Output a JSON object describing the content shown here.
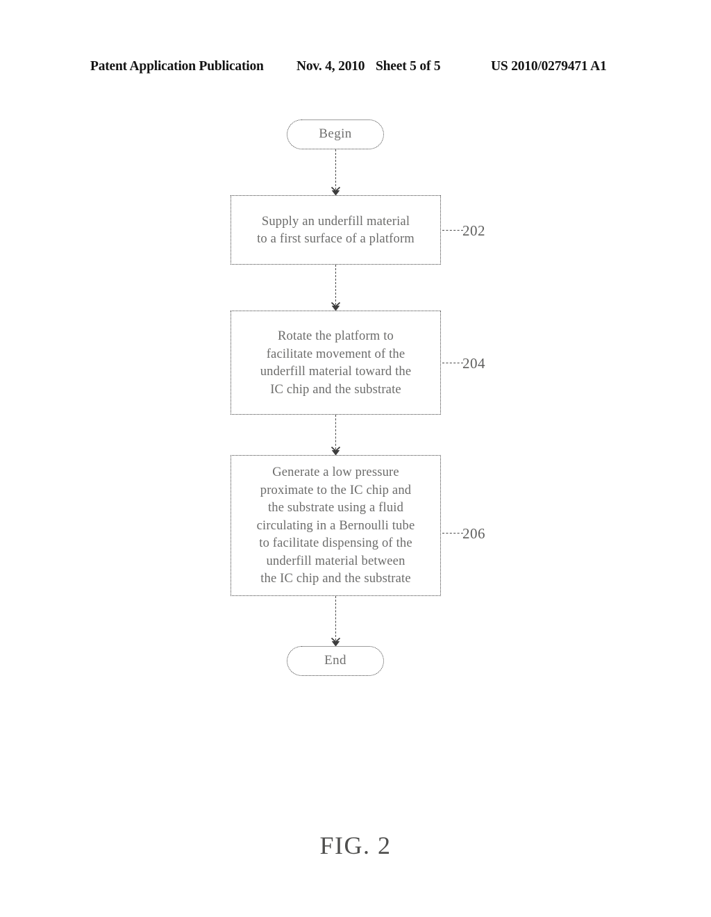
{
  "header": {
    "publication": "Patent Application Publication",
    "date": "Nov. 4, 2010",
    "sheet": "Sheet 5 of 5",
    "patent_number": "US 2010/0279471 A1"
  },
  "figure": {
    "caption": "FIG. 2",
    "ink_color": "#6c6c6b",
    "line_color": "#3d3d3d",
    "background": "#ffffff"
  },
  "flowchart": {
    "nodes": [
      {
        "id": "begin",
        "type": "terminal",
        "label": "Begin"
      },
      {
        "id": "202",
        "type": "process",
        "ref": "202",
        "text": "Supply an underfill material\nto a first surface of a platform"
      },
      {
        "id": "204",
        "type": "process",
        "ref": "204",
        "text": "Rotate the platform to\nfacilitate movement of the\nunderfill material toward the\nIC chip and the substrate"
      },
      {
        "id": "206",
        "type": "process",
        "ref": "206",
        "text": "Generate a low pressure\nproximate to the IC chip and\nthe substrate using a fluid\ncirculating in a Bernoulli tube\nto facilitate dispensing of the\nunderfill material  between\nthe  IC chip and the substrate"
      },
      {
        "id": "end",
        "type": "terminal",
        "label": "End"
      }
    ],
    "edges": [
      {
        "from": "begin",
        "to": "202",
        "style": "dashed",
        "arrow": true
      },
      {
        "from": "202",
        "to": "204",
        "style": "dashed",
        "arrow": true
      },
      {
        "from": "204",
        "to": "206",
        "style": "dashed",
        "arrow": true
      },
      {
        "from": "206",
        "to": "end",
        "style": "dashed",
        "arrow": true
      }
    ]
  }
}
